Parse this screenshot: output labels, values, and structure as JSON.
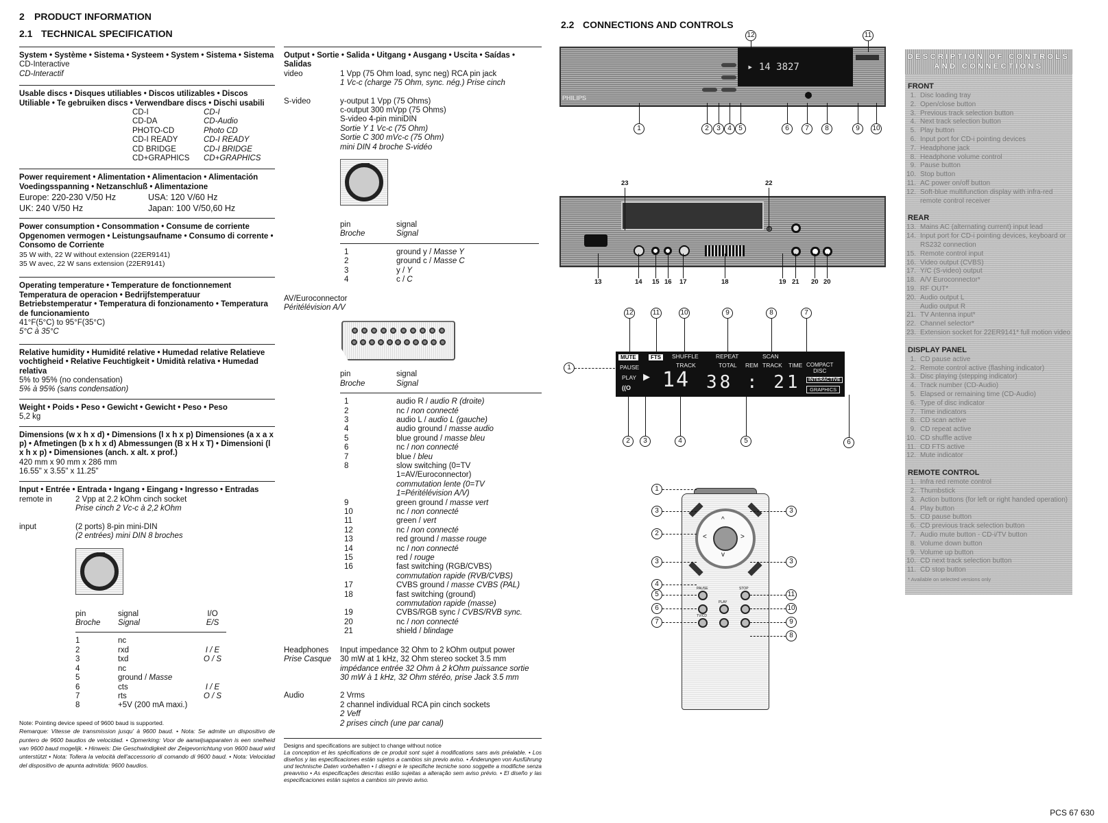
{
  "section": {
    "number": "2",
    "title": "PRODUCT INFORMATION",
    "sub_number": "2.1",
    "sub_title": "TECHNICAL SPECIFICATION",
    "conn_number": "2.2",
    "conn_title": "CONNECTIONS AND CONTROLS"
  },
  "specs_left": {
    "system": {
      "heading": "System • Système • Sistema • Systeem • System • Sistema • Sistema",
      "value": "CD-Interactive",
      "value_fr": "CD-Interactif"
    },
    "discs": {
      "heading": "Usable discs • Disques utiliables • Discos utilizables • Discos Utiliable • Te gebruiken discs • Verwendbare discs • Dischi usabili",
      "items": [
        {
          "en": "CD-I",
          "fr": "CD-I"
        },
        {
          "en": "CD-DA",
          "fr": "CD-Audio"
        },
        {
          "en": "PHOTO-CD",
          "fr": "Photo CD"
        },
        {
          "en": "CD-I READY",
          "fr": "CD-I READY"
        },
        {
          "en": "CD BRIDGE",
          "fr": "CD-I BRIDGE"
        },
        {
          "en": "CD+GRAPHICS",
          "fr": "CD+GRAPHICS"
        }
      ]
    },
    "power_req": {
      "heading": "Power requirement • Alimentation • Alimentacion • Alimentación Voedingsspanning • Netzanschluß • Alimentazione",
      "europe": "Europe: 220-230 V/50 Hz",
      "usa": "USA: 120 V/60 Hz",
      "uk": "UK: 240 V/50 Hz",
      "japan": "Japan: 100 V/50,60 Hz"
    },
    "power_cons": {
      "heading": "Power consumption • Consommation • Consume de corriente Opgenomen vermogen • Leistungsaufname • Consumo di corrente • Consomo de Corriente",
      "value": "35 W with, 22 W without extension (22ER9141)",
      "value_fr": "35 W avec, 22 W sans extension (22ER9141)"
    },
    "temp": {
      "heading": "Operating temperature • Temperature de fonctionnement Temperatura de operacion • Bedrijfstemperatuur Betriebstemperatur • Temperatura di fonzionamento • Temperatura de funcionamiento",
      "value": "41°F(5°C) to 95°F(35°C)",
      "value_fr": "5°C à 35°C"
    },
    "humidity": {
      "heading": "Relative humidity • Humidité relative • Humedad relative Relatieve vochtigheid • Relative Feuchtigkeit • Umidità relativa • Humedad relativa",
      "value": "5% to 95% (no condensation)",
      "value_fr": "5% à 95% (sans condensation)"
    },
    "weight": {
      "heading": "Weight • Poids • Peso • Gewicht • Gewicht • Peso • Peso",
      "value": "5,2 kg"
    },
    "dimensions": {
      "heading": "Dimensions (w x h x d) • Dimensions (l x h x p) Dimensiones (a x a x p) • Afmetingen (b x h x d) Abmessungen (B x H x T) • Dimensioni (l x h x p) • Dimensiones (anch. x alt. x prof.)",
      "value": "420 mm x 90 mm x 286 mm",
      "value_in": "16.55\" x 3.55\" x 11.25\""
    },
    "input": {
      "heading": "Input • Entrée • Entrada • Ingang • Eingang • Ingresso • Entradas",
      "remote_label": "remote in",
      "remote_value": "2 Vpp at 2.2 kOhm cinch socket",
      "remote_value_fr": "Prise cinch 2 Vc-c à 2,2 kOhm",
      "input_label": "input",
      "input_value": "(2 ports) 8-pin mini-DIN",
      "input_value_fr": "(2 entrées) mini DIN 8 broches",
      "pin_header": {
        "pin": "pin",
        "pin_fr": "Broche",
        "signal": "signal",
        "signal_fr": "Signal",
        "io": "I/O",
        "io_fr": "E/S"
      },
      "pins": [
        {
          "pin": "1",
          "signal": "nc",
          "signal_fr": "",
          "io": ""
        },
        {
          "pin": "2",
          "signal": "rxd",
          "signal_fr": "",
          "io": "I / E"
        },
        {
          "pin": "3",
          "signal": "txd",
          "signal_fr": "",
          "io": "O / S"
        },
        {
          "pin": "4",
          "signal": "nc",
          "signal_fr": "",
          "io": ""
        },
        {
          "pin": "5",
          "signal": "ground / ",
          "signal_fr": "Masse",
          "io": ""
        },
        {
          "pin": "6",
          "signal": "cts",
          "signal_fr": "",
          "io": "I / E"
        },
        {
          "pin": "7",
          "signal": "rts",
          "signal_fr": "",
          "io": "O / S"
        },
        {
          "pin": "8",
          "signal": "+5V (200 mA maxi.)",
          "signal_fr": "",
          "io": ""
        }
      ]
    },
    "note": {
      "en": "Note: Pointing device speed of 9600 baud is supported.",
      "multi": "Remarque: Vitesse de transmission jusqu' à 9600 baud. • Nota: Se admite un dispositivo de puntero de 9600 baudios de velocidad. • Opmerking: Voor de aanwijsapparaten is een snelheid van 9600 baud mogelijk. • Hinweis: Die Geschwindigkeit der Zeigevorrichtung von 9600 baud wird unterstützt • Nota: Tollera la velocità dell'accessorio di comando di 9600 baud. • Nota: Velocidad del dispositivo de apunta admitida: 9600 baudios."
    }
  },
  "specs_mid": {
    "output": {
      "heading": "Output • Sortie • Salida • Uitgang • Ausgang • Uscita • Saídas • Salidas",
      "video_label": "video",
      "video_value": "1 Vpp (75 Ohm load, sync neg) RCA pin jack",
      "video_value_fr": "1 Vc-c (charge 75 Ohm, sync. nég.) Prise cinch",
      "svideo_label": "S-video",
      "svideo_lines": [
        "y-output 1 Vpp (75 Ohms)",
        "c-output 300 mVpp (75 Ohms)",
        "S-video 4-pin miniDIN"
      ],
      "svideo_lines_fr": [
        "Sortie Y 1 Vc-c (75 Ohm)",
        "Sortie C 300 mVc-c (75 Ohm)",
        "mini DIN 4 broche S-vidéo"
      ],
      "pin_header": {
        "pin": "pin",
        "pin_fr": "Broche",
        "signal": "signal",
        "signal_fr": "Signal"
      },
      "svideo_pins": [
        {
          "pin": "1",
          "signal": "ground y / ",
          "signal_fr": "Masse Y"
        },
        {
          "pin": "2",
          "signal": "ground c / ",
          "signal_fr": "Masse C"
        },
        {
          "pin": "3",
          "signal": "y / ",
          "signal_fr": "Y"
        },
        {
          "pin": "4",
          "signal": "c / ",
          "signal_fr": "C"
        }
      ],
      "euro_label": "AV/Euroconnector",
      "euro_label_fr": "Péritélévision A/V",
      "euro_pins": [
        {
          "pin": "1",
          "signal": "audio R / ",
          "signal_fr": "audio R (droite)"
        },
        {
          "pin": "2",
          "signal": "nc / ",
          "signal_fr": "non connecté"
        },
        {
          "pin": "3",
          "signal": "audio L / ",
          "signal_fr": "audio L (gauche)"
        },
        {
          "pin": "4",
          "signal": "audio ground / ",
          "signal_fr": "masse audio"
        },
        {
          "pin": "5",
          "signal": "blue ground / ",
          "signal_fr": "masse bleu"
        },
        {
          "pin": "6",
          "signal": "nc / ",
          "signal_fr": "non connecté"
        },
        {
          "pin": "7",
          "signal": "blue / ",
          "signal_fr": "bleu"
        },
        {
          "pin": "8",
          "signal": "slow switching (0=TV 1=AV/Euroconnector)",
          "signal_fr": "commutation lente (0=TV 1=Péritélévision A/V)"
        },
        {
          "pin": "9",
          "signal": "green ground / ",
          "signal_fr": "masse vert"
        },
        {
          "pin": "10",
          "signal": "nc / ",
          "signal_fr": "non connecté"
        },
        {
          "pin": "11",
          "signal": "green / ",
          "signal_fr": "vert"
        },
        {
          "pin": "12",
          "signal": "nc / ",
          "signal_fr": "non connecté"
        },
        {
          "pin": "13",
          "signal": "red ground / ",
          "signal_fr": "masse rouge"
        },
        {
          "pin": "14",
          "signal": "nc / ",
          "signal_fr": "non connecté"
        },
        {
          "pin": "15",
          "signal": "red / ",
          "signal_fr": "rouge"
        },
        {
          "pin": "16",
          "signal": "fast switching (RGB/CVBS)",
          "signal_fr": "commutation rapide (RVB/CVBS)"
        },
        {
          "pin": "17",
          "signal": "CVBS ground / ",
          "signal_fr": "masse CVBS (PAL)"
        },
        {
          "pin": "18",
          "signal": "fast switching (ground)",
          "signal_fr": "commutation rapide (masse)"
        },
        {
          "pin": "19",
          "signal": "CVBS/RGB sync / ",
          "signal_fr": "CVBS/RVB sync."
        },
        {
          "pin": "20",
          "signal": "nc / ",
          "signal_fr": "non connecté"
        },
        {
          "pin": "21",
          "signal": "shield / ",
          "signal_fr": "blindage"
        }
      ],
      "headphones_label": "Headphones",
      "headphones_label_fr": "Prise Casque",
      "headphones_lines": [
        "Input impedance 32 Ohm to 2 kOhm output power",
        "30 mW at 1 kHz, 32 Ohm stereo socket 3.5 mm"
      ],
      "headphones_lines_fr": [
        "impédance entrée 32 Ohm à 2 kOhm puissance sortie",
        "30 mW à 1 kHz, 32 Ohm stéréo, prise Jack 3.5 mm"
      ],
      "audio_label": "Audio",
      "audio_lines": [
        "2 Vrms",
        "2 channel individual RCA pin cinch sockets"
      ],
      "audio_lines_fr": [
        "2 Veff",
        "2 prises cinch (une par canal)"
      ]
    },
    "disclaimer": {
      "en": "Designs and specifications are subject to change without notice",
      "multi": "La conception et les spécifications de ce produit sont sujet à modifications sans avis préalable. • Los diseños y las especificaciones están sujetos a cambios sin previo aviso. • Änderungen von Ausführung und technische Daten vorbehalten • I disegni e le specifiche tecniche sono soggette a modifiche senza preavviso • As especificações descritas estão sujeitas a alteração sem aviso prévio. • El diseño y las especificaciones están sujetos a cambios sin previo aviso."
    }
  },
  "diagrams": {
    "front_brand": "PHILIPS",
    "front_callouts": [
      "1",
      "2",
      "3",
      "4",
      "5",
      "6",
      "7",
      "8",
      "9",
      "10",
      "11",
      "12"
    ],
    "rear_callouts": [
      "13",
      "14",
      "15",
      "16",
      "17",
      "18",
      "19",
      "21",
      "20",
      "20",
      "22",
      "23"
    ],
    "display": {
      "mute": "MUTE",
      "fts": "FTS",
      "shuffle": "SHUFFLE",
      "repeat": "REPEAT",
      "scan": "SCAN",
      "track": "TRACK",
      "total": "TOTAL",
      "rem": "REM",
      "track2": "TRACK",
      "time": "TIME",
      "pause": "PAUSE",
      "play": "PLAY",
      "remote_ind": "((O",
      "track_num": "14",
      "time_val": "38 : 21",
      "compact": "COMPACT",
      "disc": "DISC",
      "interactive": "INTERACTIVE",
      "graphics": "GRAPHICS",
      "top_callouts": [
        "12",
        "11",
        "10",
        "9",
        "8",
        "7"
      ],
      "left_callout": "1",
      "bottom_callouts": [
        "2",
        "3",
        "4",
        "5",
        "6"
      ]
    },
    "remote": {
      "callouts_left": [
        "1",
        "3",
        "2",
        "3",
        "4",
        "5",
        "6",
        "7"
      ],
      "callouts_right": [
        "3",
        "3",
        "11",
        "10",
        "9",
        "8"
      ],
      "buttons": {
        "pause": "PAUSE",
        "stop": "STOP",
        "play": "PLAY",
        "tvcd": "TV/CD"
      }
    }
  },
  "description": {
    "title_line1": "DESCRIPTION OF CONTROLS",
    "title_line2": "AND CONNECTIONS",
    "front": {
      "heading": "FRONT",
      "items": [
        {
          "n": "1.",
          "t": "Disc loading tray"
        },
        {
          "n": "2.",
          "t": "Open/close button"
        },
        {
          "n": "3.",
          "t": "Previous track selection button"
        },
        {
          "n": "4.",
          "t": "Next track selection button"
        },
        {
          "n": "5.",
          "t": "Play button"
        },
        {
          "n": "6.",
          "t": "Input port for CD-i pointing devices"
        },
        {
          "n": "7.",
          "t": "Headphone jack"
        },
        {
          "n": "8.",
          "t": "Headphone volume control"
        },
        {
          "n": "9.",
          "t": "Pause button"
        },
        {
          "n": "10.",
          "t": "Stop button"
        },
        {
          "n": "11.",
          "t": "AC power on/off button"
        },
        {
          "n": "12.",
          "t": "Soft-blue multifunction display with infra-red remote control receiver"
        }
      ]
    },
    "rear": {
      "heading": "REAR",
      "items": [
        {
          "n": "13.",
          "t": "Mains AC (alternating current) input lead"
        },
        {
          "n": "14.",
          "t": "Input port for CD-i pointing devices, keyboard or RS232 connection"
        },
        {
          "n": "15.",
          "t": "Remote control input"
        },
        {
          "n": "16.",
          "t": "Video output (CVBS)"
        },
        {
          "n": "17.",
          "t": "Y/C (S-video) output"
        },
        {
          "n": "18.",
          "t": "A/V Euroconnector*"
        },
        {
          "n": "19.",
          "t": "RF OUT*"
        },
        {
          "n": "20.",
          "t": "Audio output L"
        },
        {
          "n": "",
          "t": "Audio output R"
        },
        {
          "n": "21.",
          "t": "TV Antenna input*"
        },
        {
          "n": "22.",
          "t": "Channel selector*"
        },
        {
          "n": "23.",
          "t": "Extension socket for 22ER9141* full motion video"
        }
      ]
    },
    "display": {
      "heading": "DISPLAY PANEL",
      "items": [
        {
          "n": "1.",
          "t": "CD pause active"
        },
        {
          "n": "2.",
          "t": "Remote control active (flashing indicator)"
        },
        {
          "n": "3.",
          "t": "Disc playing (stepping indicator)"
        },
        {
          "n": "4.",
          "t": "Track number (CD-Audio)"
        },
        {
          "n": "5.",
          "t": "Elapsed or remaining time (CD-Audio)"
        },
        {
          "n": "6.",
          "t": "Type of disc indicator"
        },
        {
          "n": "7.",
          "t": "Time indicators"
        },
        {
          "n": "8.",
          "t": "CD scan active"
        },
        {
          "n": "9.",
          "t": "CD repeat active"
        },
        {
          "n": "10.",
          "t": "CD shuffle active"
        },
        {
          "n": "11.",
          "t": "CD FTS active"
        },
        {
          "n": "12.",
          "t": "Mute indicator"
        }
      ]
    },
    "remote": {
      "heading": "REMOTE CONTROL",
      "items": [
        {
          "n": "1.",
          "t": "Infra red remote control"
        },
        {
          "n": "2.",
          "t": "Thumbstick"
        },
        {
          "n": "3.",
          "t": "Action buttons (for left or right handed operation)"
        },
        {
          "n": "4.",
          "t": "Play button"
        },
        {
          "n": "5.",
          "t": "CD pause button"
        },
        {
          "n": "6.",
          "t": "CD previous track selection button"
        },
        {
          "n": "7.",
          "t": "Audio mute button - CD-i/TV button"
        },
        {
          "n": "8.",
          "t": "Volume down button"
        },
        {
          "n": "9.",
          "t": "Volume up button"
        },
        {
          "n": "10.",
          "t": "CD next track selection button"
        },
        {
          "n": "11.",
          "t": "CD stop button"
        }
      ],
      "footnote": "* Available on selected versions only"
    }
  },
  "footer": {
    "code": "PCS 67 630"
  }
}
